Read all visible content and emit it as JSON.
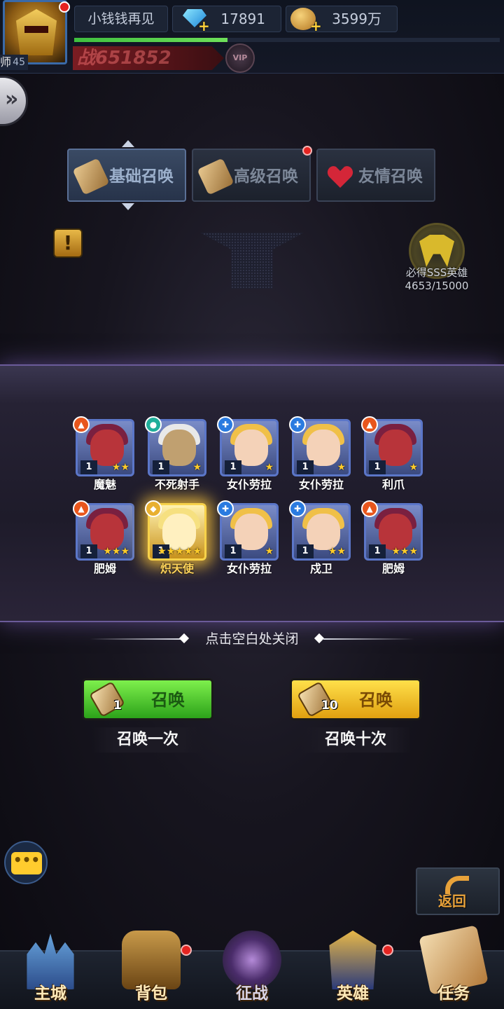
{
  "header": {
    "player_name": "小钱钱再见",
    "level": "45",
    "edge_char": "师",
    "diamonds": "17891",
    "gold": "3599万",
    "power": "战651852",
    "vip_label": "VIP",
    "exp_progress": 0.36
  },
  "tabs": [
    {
      "label": "基础召唤",
      "active": true
    },
    {
      "label": "高级召唤",
      "active": false,
      "has_dot": true
    },
    {
      "label": "友情召唤",
      "active": false
    }
  ],
  "guarantee": {
    "title": "必得SSS英雄",
    "progress_text": "4653/15000"
  },
  "info_button": "!",
  "results": [
    {
      "name": "魔魅",
      "level": "1",
      "stars": 2,
      "class": "orange"
    },
    {
      "name": "不死射手",
      "level": "1",
      "stars": 1,
      "class": "teal"
    },
    {
      "name": "女仆劳拉",
      "level": "1",
      "stars": 1,
      "class": "blue"
    },
    {
      "name": "女仆劳拉",
      "level": "1",
      "stars": 1,
      "class": "blue"
    },
    {
      "name": "利爪",
      "level": "1",
      "stars": 1,
      "class": "orange"
    },
    {
      "name": "肥姆",
      "level": "1",
      "stars": 3,
      "class": "orange"
    },
    {
      "name": "炽天使",
      "level": "1",
      "stars": 5,
      "class": "gold",
      "legendary": true
    },
    {
      "name": "女仆劳拉",
      "level": "1",
      "stars": 1,
      "class": "blue"
    },
    {
      "name": "戍卫",
      "level": "1",
      "stars": 2,
      "class": "blue"
    },
    {
      "name": "肥姆",
      "level": "1",
      "stars": 3,
      "class": "orange"
    }
  ],
  "close_hint": "点击空白处关闭",
  "summon_once": {
    "button_label": "召唤",
    "count": "1",
    "caption": "召唤一次"
  },
  "summon_ten": {
    "button_label": "召唤",
    "count": "10",
    "caption": "召唤十次"
  },
  "chat_icon": "•••",
  "back_label": "返回",
  "bottom_nav": [
    {
      "label": "主城",
      "icon": "castle-icon"
    },
    {
      "label": "背包",
      "icon": "backpack-icon",
      "has_dot": true
    },
    {
      "label": "征战",
      "icon": "dragon-portal-icon",
      "active": true
    },
    {
      "label": "英雄",
      "icon": "helmet-icon",
      "has_dot": true
    },
    {
      "label": "任务",
      "icon": "quest-scroll-icon"
    }
  ],
  "colors": {
    "accent_gold": "#ffcc2a",
    "alert_red": "#e52421",
    "summon_green": "#2ca21a",
    "summon_yellow": "#e0a010"
  }
}
